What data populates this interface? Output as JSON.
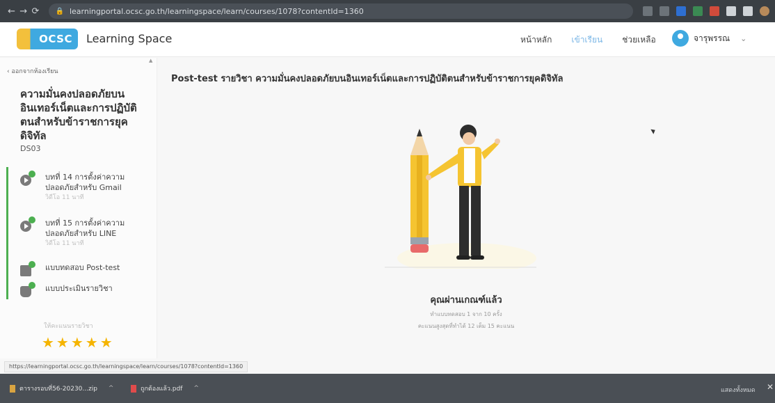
{
  "browser": {
    "url": "learningportal.ocsc.go.th/learningspace/learn/courses/1078?contentId=1360"
  },
  "header": {
    "logo_text": "OCSC",
    "app_name": "Learning Space",
    "nav": [
      {
        "label": "หน้าหลัก"
      },
      {
        "label": "เข้าเรียน"
      },
      {
        "label": "ช่วยเหลือ"
      }
    ],
    "user_name": "จารุพรรณ"
  },
  "sidebar": {
    "back_label": "ออกจากห้องเรียน",
    "course_title": "ความมั่นคงปลอดภัยบนอินเทอร์เน็ตและการปฏิบัติตนสำหรับข้าราชการยุคดิจิทัล",
    "course_code": "DS03",
    "lessons": [
      {
        "title": "บทที่ 14 การตั้งค่าความปลอดภัยสำหรับ Gmail",
        "duration": "วิดีโอ 11 นาที"
      },
      {
        "title": "บทที่ 15 การตั้งค่าความปลอดภัยสำหรับ LINE",
        "duration": "วิดีโอ 11 นาที"
      },
      {
        "title": "แบบทดสอบ Post-test",
        "duration": ""
      },
      {
        "title": "แบบประเมินรายวิชา",
        "duration": ""
      }
    ],
    "rating_label": "ให้คะแนนรายวิชา",
    "stars": "★★★★★"
  },
  "main": {
    "title": "Post-test รายวิชา ความมั่นคงปลอดภัยบนอินเทอร์เน็ตและการปฏิบัติตนสำหรับข้าราชการยุคดิจิทัล",
    "pass_title": "คุณผ่านเกณฑ์แล้ว",
    "attempts": "ทำแบบทดสอบ 1 จาก 10 ครั้ง",
    "score": "คะแนนสูงสุดที่ทำได้ 12 เต็ม 15 คะแนน"
  },
  "status_url": "https://learningportal.ocsc.go.th/learningspace/learn/courses/1078?contentId=1360",
  "downloads": {
    "items": [
      {
        "name": "ตารางรอบที่56-20230...zip"
      },
      {
        "name": "ถูกต้องแล้ว.pdf"
      }
    ],
    "show_all": "แสดงทั้งหมด"
  }
}
